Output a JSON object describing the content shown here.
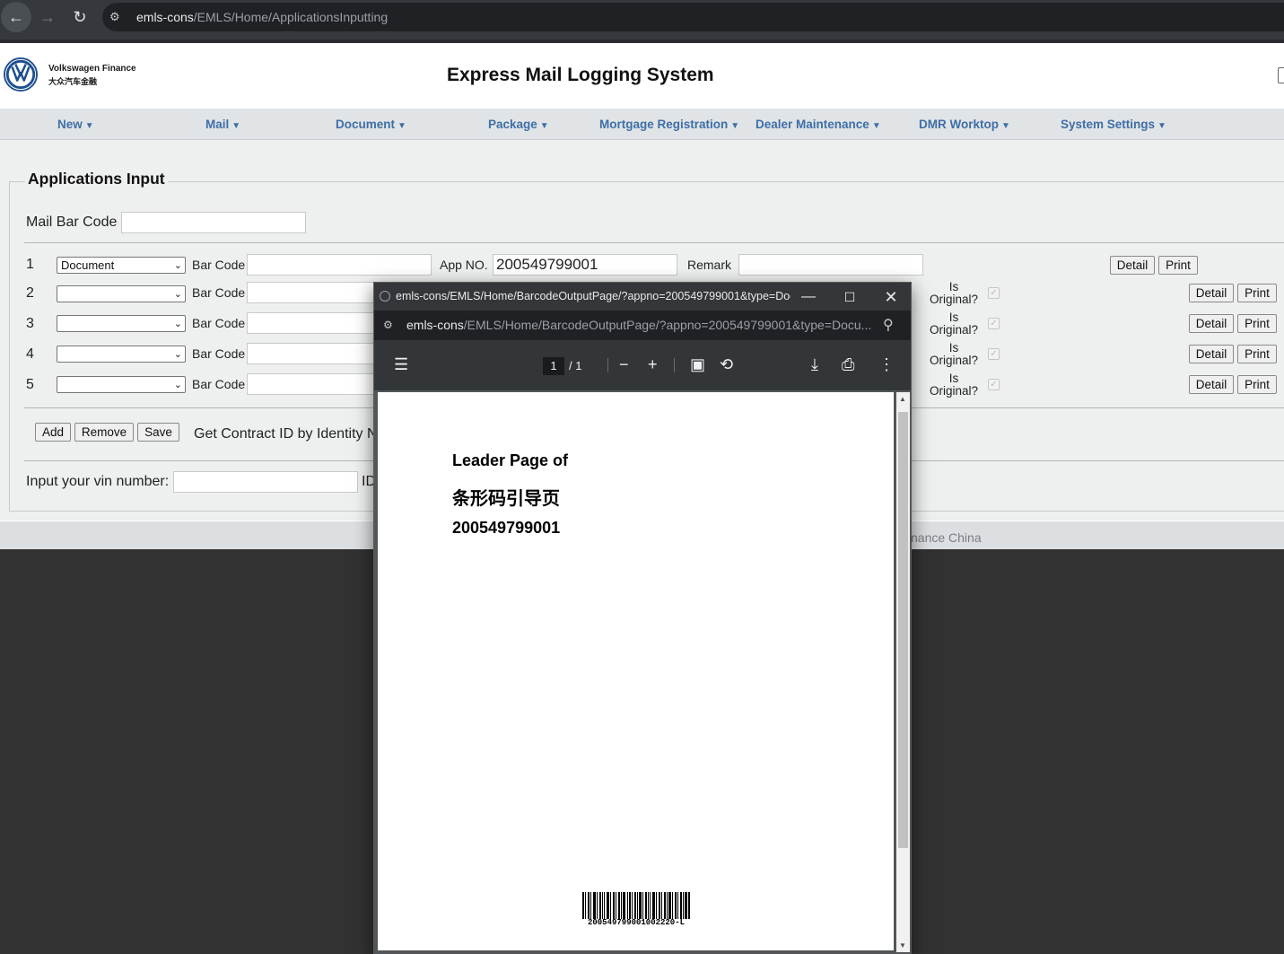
{
  "browser": {
    "url_host": "emls-cons",
    "url_path": "/EMLS/Home/ApplicationsInputting"
  },
  "header": {
    "brand_en": "Volkswagen Finance",
    "brand_cn": "大众汽车金融",
    "title": "Express Mail Logging System"
  },
  "menu": [
    {
      "label": "New"
    },
    {
      "label": "Mail"
    },
    {
      "label": "Document"
    },
    {
      "label": "Package"
    },
    {
      "label": "Mortgage Registration"
    },
    {
      "label": "Dealer Maintenance"
    },
    {
      "label": "DMR Worktop"
    },
    {
      "label": "System Settings"
    }
  ],
  "form": {
    "legend": "Applications Input",
    "mail_bar_code_label": "Mail Bar Code",
    "mail_bar_code_value": "",
    "bar_code_label": "Bar Code",
    "app_no_label": "App NO.",
    "app_no_value": "200549799001",
    "remark_label": "Remark",
    "is_original_label": "Is Original?",
    "detail_label": "Detail",
    "print_label": "Print",
    "rows": [
      {
        "num": "1",
        "type": "Document"
      },
      {
        "num": "2",
        "type": ""
      },
      {
        "num": "3",
        "type": ""
      },
      {
        "num": "4",
        "type": ""
      },
      {
        "num": "5",
        "type": ""
      }
    ],
    "add_label": "Add",
    "remove_label": "Remove",
    "save_label": "Save",
    "contract_label": "Get Contract ID by Identity N",
    "vin_label": "Input your vin number:",
    "id_label": "ID"
  },
  "footer": {
    "copyright": "nance China"
  },
  "popup": {
    "title": "emls-cons/EMLS/Home/BarcodeOutputPage/?appno=200549799001&type=Doc...",
    "url_host": "emls-cons",
    "url_path": "/EMLS/Home/BarcodeOutputPage/?appno=200549799001&type=Docu...",
    "current_page": "1",
    "page_total": "/ 1",
    "pdf": {
      "line1": "Leader Page of",
      "line2": "条形码引导页",
      "line3": "200549799001",
      "barcode_text": "200549799001002220-L"
    }
  },
  "icons": {
    "back": "back-arrow-icon",
    "forward": "forward-arrow-icon",
    "reload": "reload-icon",
    "site_info": "site-settings-icon",
    "menu": "hamburger-icon",
    "zoom_out": "minus-icon",
    "zoom_in": "plus-icon",
    "fit": "fit-page-icon",
    "rotate": "rotate-icon",
    "download": "download-icon",
    "print": "print-icon",
    "more": "more-vertical-icon"
  },
  "colors": {
    "menu_text": "#3f6ea8",
    "chrome_bg": "#35393d",
    "pdf_toolbar": "#323639"
  }
}
